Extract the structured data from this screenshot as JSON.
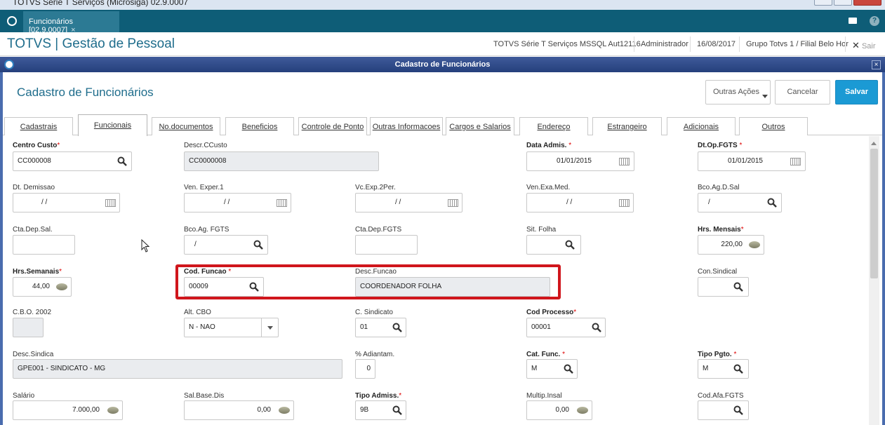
{
  "window": {
    "title": "TOTVS Série T Serviços (Microsiga) 02.9.0007"
  },
  "top": {
    "tab_label": "Funcionários [02.9.0007]",
    "tab_close": "×",
    "help": "?"
  },
  "header": {
    "app_title": "TOTVS | Gestão de Pessoal",
    "server": "TOTVS Série T Serviços MSSQL Aut12116",
    "user": "Administrador",
    "date": "16/08/2017",
    "group": "Grupo Totvs 1 / Filial Belo Hor",
    "logout": "Sair",
    "logout_icon": "✕"
  },
  "dialog": {
    "title": "Cadastro de Funcionários",
    "close": "×"
  },
  "form": {
    "title": "Cadastro de Funcionários",
    "more_actions": "Outras Ações",
    "cancel": "Cancelar",
    "save": "Salvar"
  },
  "tabs": [
    "Cadastrais",
    "Funcionais",
    "No.documentos",
    "Beneficios",
    "Controle de Ponto",
    "Outras Informacoes",
    "Cargos e Salarios",
    "Endereço",
    "Estrangeiro",
    "Adicionais",
    "Outros"
  ],
  "active_tab": "Funcionais",
  "fields": {
    "centro_custo": {
      "label": "Centro Custo",
      "required": true,
      "value": "CC000008"
    },
    "descr_ccusto": {
      "label": "Descr.CCusto",
      "value": "CC0000008"
    },
    "data_admis": {
      "label": "Data Admis.",
      "required": true,
      "value": "01/01/2015"
    },
    "dt_op_fgts": {
      "label": "Dt.Op.FGTS",
      "required": true,
      "value": "01/01/2015"
    },
    "dt_demissao": {
      "label": "Dt. Demissao",
      "value": "/ /"
    },
    "ven_exper1": {
      "label": "Ven. Exper.1",
      "value": "/ /"
    },
    "vc_exp_2per": {
      "label": "Vc.Exp.2Per.",
      "value": "/ /"
    },
    "ven_exa_med": {
      "label": "Ven.Exa.Med.",
      "value": "/ /"
    },
    "bco_ag_d_sal": {
      "label": "Bco.Ag.D.Sal",
      "value": "/"
    },
    "cta_dep_sal": {
      "label": "Cta.Dep.Sal.",
      "value": ""
    },
    "bco_ag_fgts": {
      "label": "Bco.Ag. FGTS",
      "value": "/"
    },
    "cta_dep_fgts": {
      "label": "Cta.Dep.FGTS",
      "value": ""
    },
    "sit_folha": {
      "label": "Sit. Folha",
      "value": ""
    },
    "hrs_mensais": {
      "label": "Hrs. Mensais",
      "required": true,
      "value": "220,00"
    },
    "hrs_semanais": {
      "label": "Hrs.Semanais",
      "required": true,
      "value": "44,00"
    },
    "cod_funcao": {
      "label": "Cod. Funcao",
      "required": true,
      "value": "00009"
    },
    "desc_funcao": {
      "label": "Desc.Funcao",
      "value": "COORDENADOR FOLHA"
    },
    "con_sindical": {
      "label": "Con.Sindical",
      "value": ""
    },
    "cbo_2002": {
      "label": "C.B.O. 2002",
      "value": ""
    },
    "alt_cbo": {
      "label": "Alt. CBO",
      "value": "N - NAO"
    },
    "c_sindicato": {
      "label": "C. Sindicato",
      "value": "01"
    },
    "cod_processo": {
      "label": "Cod Processo",
      "required": true,
      "value": "00001"
    },
    "desc_sindica": {
      "label": "Desc.Sindica",
      "value": "GPE001 - SINDICATO - MG"
    },
    "pct_adiantam": {
      "label": "% Adiantam.",
      "value": "0"
    },
    "cat_func": {
      "label": "Cat. Func.",
      "required": true,
      "value": "M"
    },
    "tipo_pgto": {
      "label": "Tipo Pgto.",
      "required": true,
      "value": "M"
    },
    "salario": {
      "label": "Salário",
      "value": "7.000,00"
    },
    "sal_base_dis": {
      "label": "Sal.Base.Dis",
      "value": "0,00"
    },
    "tipo_admiss": {
      "label": "Tipo Admiss.",
      "required": true,
      "value": "9B"
    },
    "multip_insal": {
      "label": "Multip.Insal",
      "value": "0,00"
    },
    "cod_afa_fgts": {
      "label": "Cod.Afa.FGTS",
      "value": ""
    }
  },
  "star": "*",
  "colors": {
    "brand_bar": "#0e5d77",
    "dialog_bar": "#2c4786",
    "primary_button": "#1b9ad4",
    "highlight": "#d0161c"
  },
  "icons": {
    "search": "search-icon",
    "calendar": "calendar-icon",
    "coin": "money-icon"
  }
}
